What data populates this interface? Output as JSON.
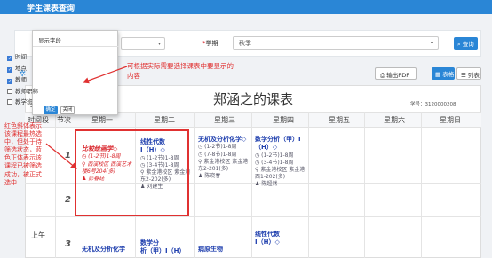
{
  "app": {
    "title": "学生课表查询"
  },
  "search": {
    "term_label": "学期",
    "term_required_mark": "*",
    "term_value": "秋季",
    "search_button": "查询"
  },
  "dropdown": {
    "title": "显示字段",
    "items": [
      {
        "label": "时间",
        "checked": true
      },
      {
        "label": "地点",
        "checked": true
      },
      {
        "label": "教师",
        "checked": true
      },
      {
        "label": "教师职称",
        "checked": false
      },
      {
        "label": "教学班",
        "checked": false
      }
    ],
    "ok_button": "确定",
    "close_button": "关闭"
  },
  "annotations": {
    "top_note_line1": "可根据实际需要选择课表中要显示的",
    "top_note_line2": "内容",
    "left_note": "红色斜体表示该课程最热选中，但处于待筛选状态，蓝色正体表示该课程已被筛选成功，被正式选中"
  },
  "toolbar": {
    "pdf_button": "输出PDF",
    "grid_view_button": "表格",
    "list_view_button": "列表"
  },
  "timetable": {
    "title": "郑涵之的课表",
    "year_fragment": "201",
    "student_id": "学号：3120000208",
    "headers": [
      "时间段",
      "节次",
      "星期一",
      "星期二",
      "星期三",
      "星期四",
      "星期五",
      "星期六",
      "星期日"
    ],
    "periods": [
      "1",
      "2",
      "3"
    ],
    "ampm": "上午",
    "courses": {
      "mon": {
        "name": "比较绘画学◇",
        "time": "(1-2节)1-8周",
        "place": "西溪校区 西溪艺术楼6号204(多)",
        "teacher": "彭春廷"
      },
      "tue": {
        "name": "线性代数",
        "sub": "Ⅰ（H）◇",
        "time": "(1-2节)1-8周",
        "time2": "(3-4节)1-8周",
        "place": "紫金港校区 紫金港东2-202(多)",
        "teacher": "刘建生"
      },
      "wed": {
        "name": "无机及分析化学◇",
        "time": "(1-2节)1-8周",
        "time2": "(7-8节)1-8周",
        "place": "紫金港校区 紫金港东2-201(多)",
        "teacher": "陈晓春"
      },
      "thu": {
        "name": "数学分析（甲）Ⅰ（H）◇",
        "time": "(1-2节)1-8周",
        "time2": "(3-4节)1-8周",
        "place": "紫金港校区 紫金港西1-202(多)",
        "teacher": "陈超然"
      },
      "row3_mon": {
        "name": "无机及分析化学"
      },
      "row3_tue": {
        "name": "数学分",
        "sub": "析（甲）Ⅰ（H）"
      },
      "row3_wed": {
        "name": "病原生物"
      },
      "row3_thu": {
        "name": "线性代数",
        "sub": "Ⅰ（H）◇"
      }
    }
  }
}
